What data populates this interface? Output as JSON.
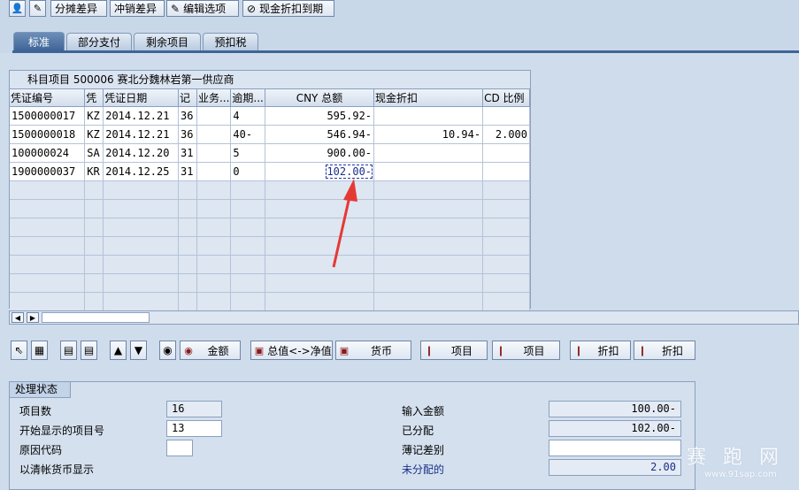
{
  "toolbar": {
    "buttons": [
      "分摊差异",
      "冲销差异",
      "编辑选项",
      "现金折扣到期"
    ]
  },
  "tabs": [
    "标准",
    "部分支付",
    "剩余项目",
    "预扣税"
  ],
  "table": {
    "title": "科目项目 500006 赛北分魏林岩第一供应商",
    "headers": [
      "凭证编号",
      "凭",
      "凭证日期",
      "记",
      "业务...",
      "逾期...",
      "CNY 总额",
      "现金折扣",
      "CD 比例"
    ],
    "rows": [
      [
        "1500000017",
        "KZ",
        "2014.12.21",
        "36",
        "",
        "4",
        "595.92-",
        "",
        ""
      ],
      [
        "1500000018",
        "KZ",
        "2014.12.21",
        "36",
        "",
        "40-",
        "546.94-",
        "10.94-",
        "2.000"
      ],
      [
        "100000024",
        "SA",
        "2014.12.20",
        "31",
        "",
        "5",
        "900.00-",
        "",
        ""
      ],
      [
        "1900000037",
        "KR",
        "2014.12.25",
        "31",
        "",
        "0",
        "102.00-",
        "",
        ""
      ]
    ]
  },
  "bottom_toolbar": {
    "amount": "金额",
    "gross_net": "总值<->净值",
    "currency": "货币",
    "item1": "项目",
    "item2": "项目",
    "discount1": "折扣",
    "discount2": "折扣"
  },
  "status": {
    "title": "处理状态",
    "item_count_label": "项目数",
    "item_count": "16",
    "first_item_label": "开始显示的项目号",
    "first_item": "13",
    "reason_code_label": "原因代码",
    "reason_code": "",
    "clearing_currency_label": "以清帐货币显示",
    "entered_amount_label": "输入金额",
    "entered_amount": "100.00-",
    "assigned_label": "已分配",
    "assigned": "102.00-",
    "difference_label": "薄记差别",
    "difference": "",
    "unassigned_label": "未分配的",
    "unassigned": "2.00"
  },
  "watermark": {
    "text": "赛 跑 网",
    "url": "www.91sap.com"
  },
  "colors": {
    "annotation_arrow": "#e53935",
    "unassigned_text": "#1a2f8a",
    "active_tab": "#3f6597"
  }
}
